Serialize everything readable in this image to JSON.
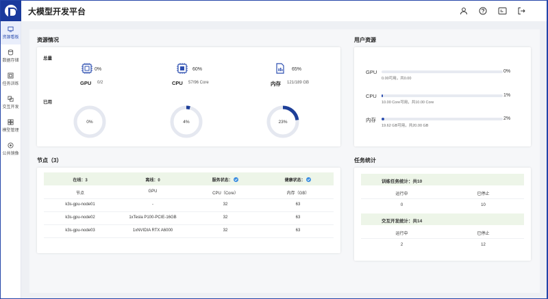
{
  "app": {
    "title": "大模型开发平台"
  },
  "sidebar": {
    "items": [
      {
        "label": "资源看板",
        "icon": "dashboard-icon",
        "active": true
      },
      {
        "label": "数据存储",
        "icon": "database-icon"
      },
      {
        "label": "任务训练",
        "icon": "training-icon"
      },
      {
        "label": "交互开发",
        "icon": "develop-icon"
      },
      {
        "label": "模型管理",
        "icon": "model-icon"
      },
      {
        "label": "公共镜像",
        "icon": "image-icon"
      }
    ]
  },
  "resources": {
    "title": "资源情况",
    "total_label": "总量",
    "used_label": "已用",
    "items": [
      {
        "name": "GPU",
        "percent": "0%",
        "ratio": "0/2",
        "icon": "gpu-icon",
        "used_fraction": 0.0,
        "donut_label": "0%"
      },
      {
        "name": "CPU",
        "percent": "60%",
        "ratio": "57/96 Core",
        "icon": "cpu-icon",
        "used_fraction": 0.04,
        "donut_label": "4%"
      },
      {
        "name": "内存",
        "percent": "65%",
        "ratio": "121/189 GB",
        "icon": "memory-icon",
        "used_fraction": 0.23,
        "donut_label": "23%"
      }
    ]
  },
  "user_resources": {
    "title": "用户资源",
    "items": [
      {
        "name": "GPU",
        "percent": "0%",
        "detail": "0.00可用，共0.00",
        "fraction": 0.0
      },
      {
        "name": "CPU",
        "percent": "1%",
        "detail": "10.00 Core可用，共10.00 Core",
        "fraction": 0.01
      },
      {
        "name": "内存",
        "percent": "2%",
        "detail": "19.62 GB可用，共20.00 GB",
        "fraction": 0.02
      }
    ]
  },
  "nodes": {
    "title": "节点（3）",
    "summary": {
      "online": "在线：3",
      "offline": "离线：0",
      "service": "服务状态：",
      "health": "健康状态："
    },
    "columns": [
      "节点",
      "GPU",
      "CPU（Core）",
      "内存（GB）"
    ],
    "rows": [
      [
        "k3s-gpu-node01",
        "-",
        "32",
        "63"
      ],
      [
        "k3s-gpu-node02",
        "1xTesla P100-PCIE-16GB",
        "32",
        "63"
      ],
      [
        "k3s-gpu-node03",
        "1xNVIDIA RTX A6000",
        "32",
        "63"
      ]
    ]
  },
  "tasks": {
    "title": "任务统计",
    "training": {
      "header": "训练任务统计：共10",
      "running_label": "运行中",
      "stopped_label": "已停止",
      "running": "0",
      "stopped": "10"
    },
    "interactive": {
      "header": "交互开发统计：共14",
      "running_label": "运行中",
      "stopped_label": "已停止",
      "running": "2",
      "stopped": "12"
    }
  },
  "colors": {
    "accent": "#2d4fb0",
    "frame": "#2344a8",
    "donut_track": "#e5e8f0",
    "ok": "#3b8de0"
  }
}
